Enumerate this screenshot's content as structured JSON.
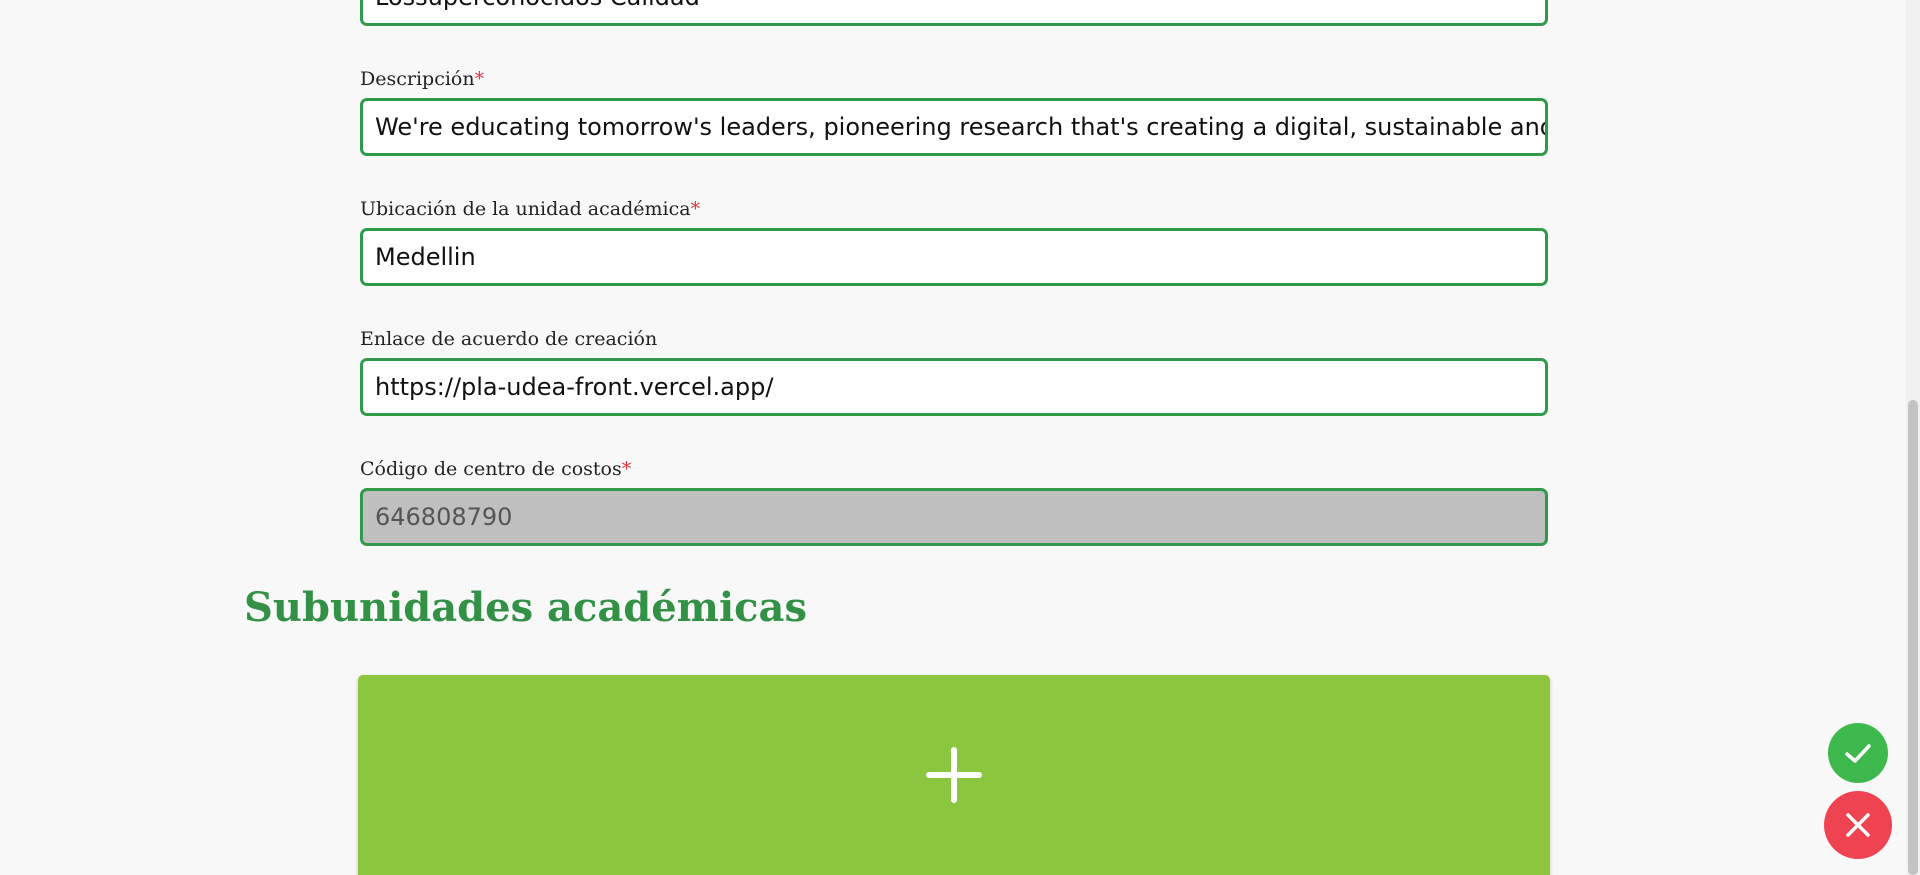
{
  "form": {
    "top_field_value": "Lossuperconocidos Calidad",
    "descripcion": {
      "label": "Descripción",
      "required_mark": "*",
      "value": "We're educating tomorrow's leaders, pioneering research that's creating a digital, sustainable and h"
    },
    "ubicacion": {
      "label": "Ubicación de la unidad académica",
      "required_mark": "*",
      "value": "Medellin"
    },
    "enlace": {
      "label": "Enlace de acuerdo de creación",
      "value": "https://pla-udea-front.vercel.app/"
    },
    "codigo": {
      "label": "Código de centro de costos",
      "required_mark": "*",
      "value": "646808790"
    }
  },
  "subunidades": {
    "title": "Subunidades académicas",
    "add_icon": "plus-icon"
  },
  "actions": {
    "confirm_icon": "check-icon",
    "cancel_icon": "close-icon"
  },
  "colors": {
    "accent_green": "#329145",
    "field_border": "#2e9a4a",
    "add_card": "#8cc63f",
    "confirm": "#3db84c",
    "cancel": "#ef4351",
    "required": "#e2343d"
  }
}
